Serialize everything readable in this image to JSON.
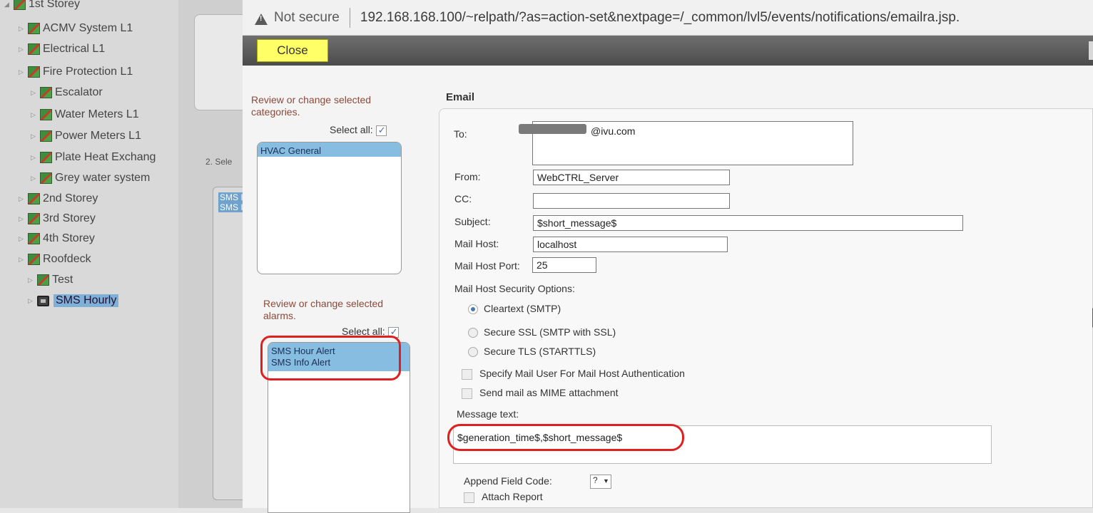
{
  "tree": {
    "items": [
      {
        "label": "1st Storey",
        "level": 0
      },
      {
        "label": "ACMV System L1",
        "level": 1
      },
      {
        "label": "Electrical L1",
        "level": 1
      },
      {
        "label": "Fire Protection L1",
        "level": 1
      },
      {
        "label": "Escalator",
        "level": 1
      },
      {
        "label": "Water Meters L1",
        "level": 1
      },
      {
        "label": "Power Meters L1",
        "level": 1
      },
      {
        "label": "Plate Heat Exchang",
        "level": 1
      },
      {
        "label": "Grey water system",
        "level": 1
      },
      {
        "label": "2nd Storey",
        "level": 0
      },
      {
        "label": "3rd Storey",
        "level": 0
      },
      {
        "label": "4th Storey",
        "level": 0
      },
      {
        "label": "Roofdeck",
        "level": 0
      },
      {
        "label": "Test",
        "level": 0
      },
      {
        "label": "SMS Hourly",
        "level": 0,
        "selected": true
      }
    ]
  },
  "background": {
    "step_label": "2. Sele",
    "list_items": [
      "SMS I",
      "SMS I"
    ]
  },
  "browser": {
    "security_label": "Not secure",
    "url": "192.168.168.100/~relpath/?as=action-set&nextpage=/_common/lvl5/events/notifications/emailra.jsp."
  },
  "toolbar": {
    "close_label": "Close"
  },
  "categories": {
    "review_text": "Review or change selected categories.",
    "select_all_label": "Select all:",
    "select_all_checked": true,
    "items": [
      {
        "label": "HVAC General",
        "selected": true
      }
    ]
  },
  "alarms": {
    "review_text": "Review or change selected alarms.",
    "select_all_label": "Select all:",
    "select_all_checked": true,
    "items": [
      {
        "label": "SMS Hour Alert",
        "selected": true
      },
      {
        "label": "SMS Info Alert",
        "selected": true
      }
    ]
  },
  "email": {
    "title": "Email",
    "to_label": "To:",
    "to_value": "@ivu.com",
    "from_label": "From:",
    "from_value": "WebCTRL_Server",
    "cc_label": "CC:",
    "cc_value": "",
    "subject_label": "Subject:",
    "subject_value": "$short_message$",
    "mail_host_label": "Mail Host:",
    "mail_host_value": "localhost",
    "mail_host_port_label": "Mail Host Port:",
    "mail_host_port_value": "25",
    "security_options_label": "Mail Host Security Options:",
    "security_options": [
      {
        "label": "Cleartext (SMTP)",
        "selected": true
      },
      {
        "label": "Secure SSL (SMTP with SSL)",
        "selected": false
      },
      {
        "label": "Secure TLS (STARTTLS)",
        "selected": false
      }
    ],
    "specify_user_label": "Specify Mail User For Mail Host Authentication",
    "mime_label": "Send mail as MIME attachment",
    "message_text_label": "Message text:",
    "message_text_value": "$generation_time$,$short_message$",
    "append_field_code_label": "Append Field Code:",
    "append_field_code_value": "?",
    "attach_report_label": "Attach Report"
  },
  "colors": {
    "highlight": "#86bde0",
    "annotation_ring": "#e02020",
    "close_button": "#ffff66"
  }
}
